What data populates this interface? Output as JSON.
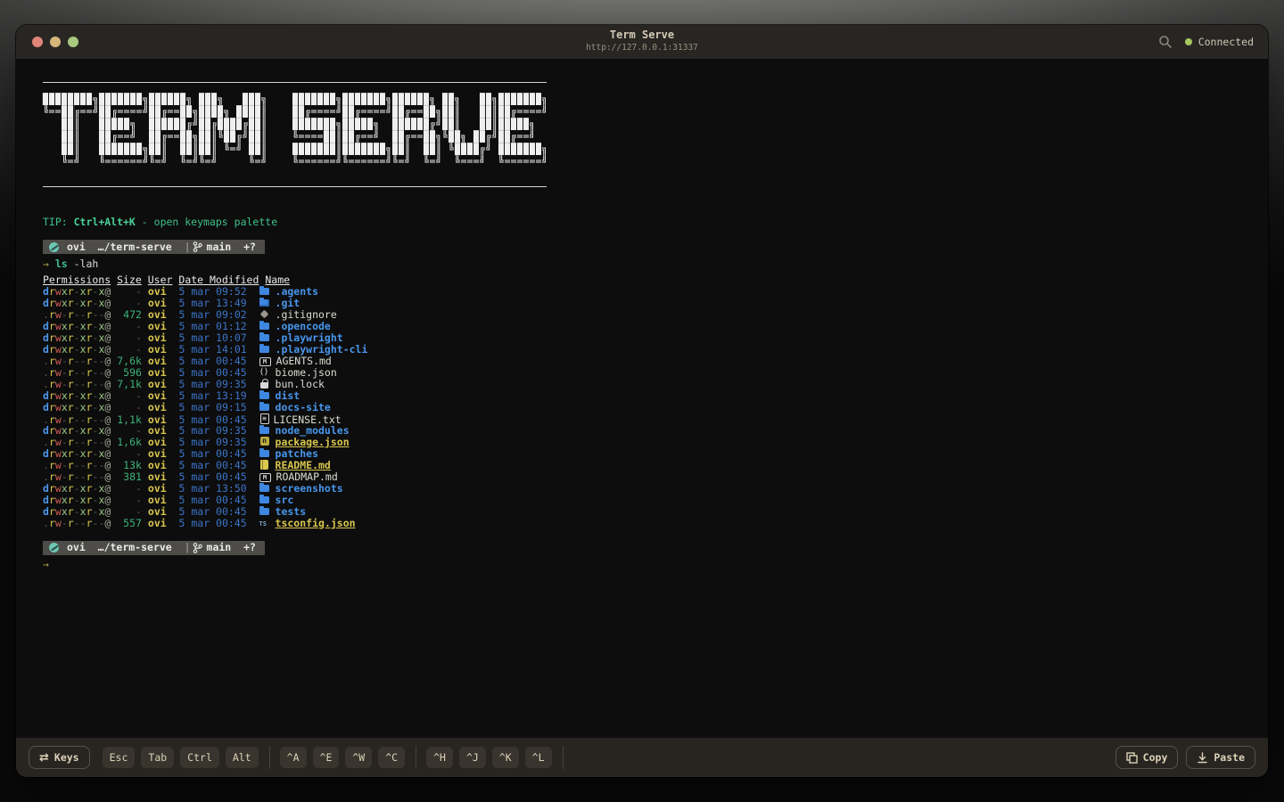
{
  "titlebar": {
    "title": "Term Serve",
    "url": "http://127.0.0.1:31337",
    "status_label": "Connected",
    "status_color": "#a5c95e"
  },
  "banner_ascii": "████████╗███████╗██████╗ ███╗   ███╗    ███████╗███████╗██████╗ ██╗   ██╗███████╗\n╚══██╔══╝██╔════╝██╔══██╗████╗ ████║    ██╔════╝██╔════╝██╔══██╗██║   ██║██╔════╝\n   ██║   █████╗  ██████╔╝██╔████╔██║    ███████╗█████╗  ██████╔╝██║   ██║█████╗  \n   ██║   ██╔══╝  ██╔══██╗██║╚██╔╝██║    ╚════██║██╔══╝  ██╔══██╗╚██╗ ██╔╝██╔══╝  \n   ██║   ███████╗██║  ██║██║ ╚═╝ ██║    ███████║███████╗██║  ██║ ╚████╔╝ ███████╗\n   ╚═╝   ╚══════╝╚═╝  ╚═╝╚═╝     ╚═╝    ╚══════╝╚══════╝╚═╝  ╚═╝  ╚═══╝  ╚══════╝",
  "tip": {
    "label": "TIP: ",
    "shortcut": "Ctrl+Alt+K",
    "rest": " - open keymaps palette"
  },
  "prompt": {
    "user": "ovi",
    "path": "…/term-serve",
    "separator": "|",
    "branch": "main",
    "git_status": "+?",
    "arrow": "→"
  },
  "command": {
    "name": "ls",
    "args": " -lah"
  },
  "listing": {
    "headers": [
      "Permissions",
      "Size",
      "User",
      "Date Modified",
      "Name"
    ],
    "files": [
      {
        "perms": "drwxr-xr-x@",
        "size": "-",
        "user": "ovi",
        "date": "5 mar 09:52",
        "icon": "folder-icon",
        "name": ".agents",
        "kind": "dir"
      },
      {
        "perms": "drwxr-xr-x@",
        "size": "-",
        "user": "ovi",
        "date": "5 mar 13:49",
        "icon": "git-folder-icon",
        "name": ".git",
        "kind": "dir"
      },
      {
        "perms": ".rw-r--r--@",
        "size": "472",
        "user": "ovi",
        "date": "5 mar 09:02",
        "icon": "git-icon",
        "name": ".gitignore",
        "kind": "file"
      },
      {
        "perms": "drwxr-xr-x@",
        "size": "-",
        "user": "ovi",
        "date": "5 mar 01:12",
        "icon": "folder-icon",
        "name": ".opencode",
        "kind": "dir"
      },
      {
        "perms": "drwxr-xr-x@",
        "size": "-",
        "user": "ovi",
        "date": "5 mar 10:07",
        "icon": "folder-icon",
        "name": ".playwright",
        "kind": "dir"
      },
      {
        "perms": "drwxr-xr-x@",
        "size": "-",
        "user": "ovi",
        "date": "5 mar 14:01",
        "icon": "folder-icon",
        "name": ".playwright-cli",
        "kind": "dir"
      },
      {
        "perms": ".rw-r--r--@",
        "size": "7,6k",
        "user": "ovi",
        "date": "5 mar 00:45",
        "icon": "markdown-icon",
        "name": "AGENTS.md",
        "kind": "file"
      },
      {
        "perms": ".rw-r--r--@",
        "size": "596",
        "user": "ovi",
        "date": "5 mar 00:45",
        "icon": "json-icon",
        "name": "biome.json",
        "kind": "file"
      },
      {
        "perms": ".rw-r--r--@",
        "size": "7,1k",
        "user": "ovi",
        "date": "5 mar 09:35",
        "icon": "lock-icon",
        "name": "bun.lock",
        "kind": "file"
      },
      {
        "perms": "drwxr-xr-x@",
        "size": "-",
        "user": "ovi",
        "date": "5 mar 13:19",
        "icon": "folder-icon",
        "name": "dist",
        "kind": "dir"
      },
      {
        "perms": "drwxr-xr-x@",
        "size": "-",
        "user": "ovi",
        "date": "5 mar 09:15",
        "icon": "folder-icon",
        "name": "docs-site",
        "kind": "dir"
      },
      {
        "perms": ".rw-r--r--@",
        "size": "1,1k",
        "user": "ovi",
        "date": "5 mar 00:45",
        "icon": "license-icon",
        "name": "LICENSE.txt",
        "kind": "file"
      },
      {
        "perms": "drwxr-xr-x@",
        "size": "-",
        "user": "ovi",
        "date": "5 mar 09:35",
        "icon": "folder-icon",
        "name": "node_modules",
        "kind": "dir"
      },
      {
        "perms": ".rw-r--r--@",
        "size": "1,6k",
        "user": "ovi",
        "date": "5 mar 09:35",
        "icon": "npm-icon",
        "name": "package.json",
        "kind": "accent"
      },
      {
        "perms": "drwxr-xr-x@",
        "size": "-",
        "user": "ovi",
        "date": "5 mar 00:45",
        "icon": "folder-icon",
        "name": "patches",
        "kind": "dir"
      },
      {
        "perms": ".rw-r--r--@",
        "size": "13k",
        "user": "ovi",
        "date": "5 mar 00:45",
        "icon": "book-icon",
        "name": "README.md",
        "kind": "accent"
      },
      {
        "perms": ".rw-r--r--@",
        "size": "381",
        "user": "ovi",
        "date": "5 mar 00:45",
        "icon": "markdown-icon",
        "name": "ROADMAP.md",
        "kind": "file"
      },
      {
        "perms": "drwxr-xr-x@",
        "size": "-",
        "user": "ovi",
        "date": "5 mar 13:50",
        "icon": "folder-icon",
        "name": "screenshots",
        "kind": "dir"
      },
      {
        "perms": "drwxr-xr-x@",
        "size": "-",
        "user": "ovi",
        "date": "5 mar 00:45",
        "icon": "folder-icon",
        "name": "src",
        "kind": "dir"
      },
      {
        "perms": "drwxr-xr-x@",
        "size": "-",
        "user": "ovi",
        "date": "5 mar 00:45",
        "icon": "folder-icon",
        "name": "tests",
        "kind": "dir"
      },
      {
        "perms": ".rw-r--r--@",
        "size": "557",
        "user": "ovi",
        "date": "5 mar 00:45",
        "icon": "ts-icon",
        "name": "tsconfig.json",
        "kind": "accent"
      }
    ]
  },
  "footer": {
    "keys_label": "Keys",
    "key_buttons": [
      "Esc",
      "Tab",
      "Ctrl",
      "Alt"
    ],
    "ctrl_buttons_1": [
      "^A",
      "^E",
      "^W",
      "^C"
    ],
    "ctrl_buttons_2": [
      "^H",
      "^J",
      "^K",
      "^L"
    ],
    "copy_label": "Copy",
    "paste_label": "Paste"
  },
  "colors": {
    "dir_blue": "#4896ec",
    "date_blue": "#3b74c8",
    "size_green": "#3cb278",
    "tip_green": "#3ec08a",
    "user_yellow": "#d8c64e",
    "perm_red": "#cf5b56",
    "connected_green": "#a5c95e"
  }
}
